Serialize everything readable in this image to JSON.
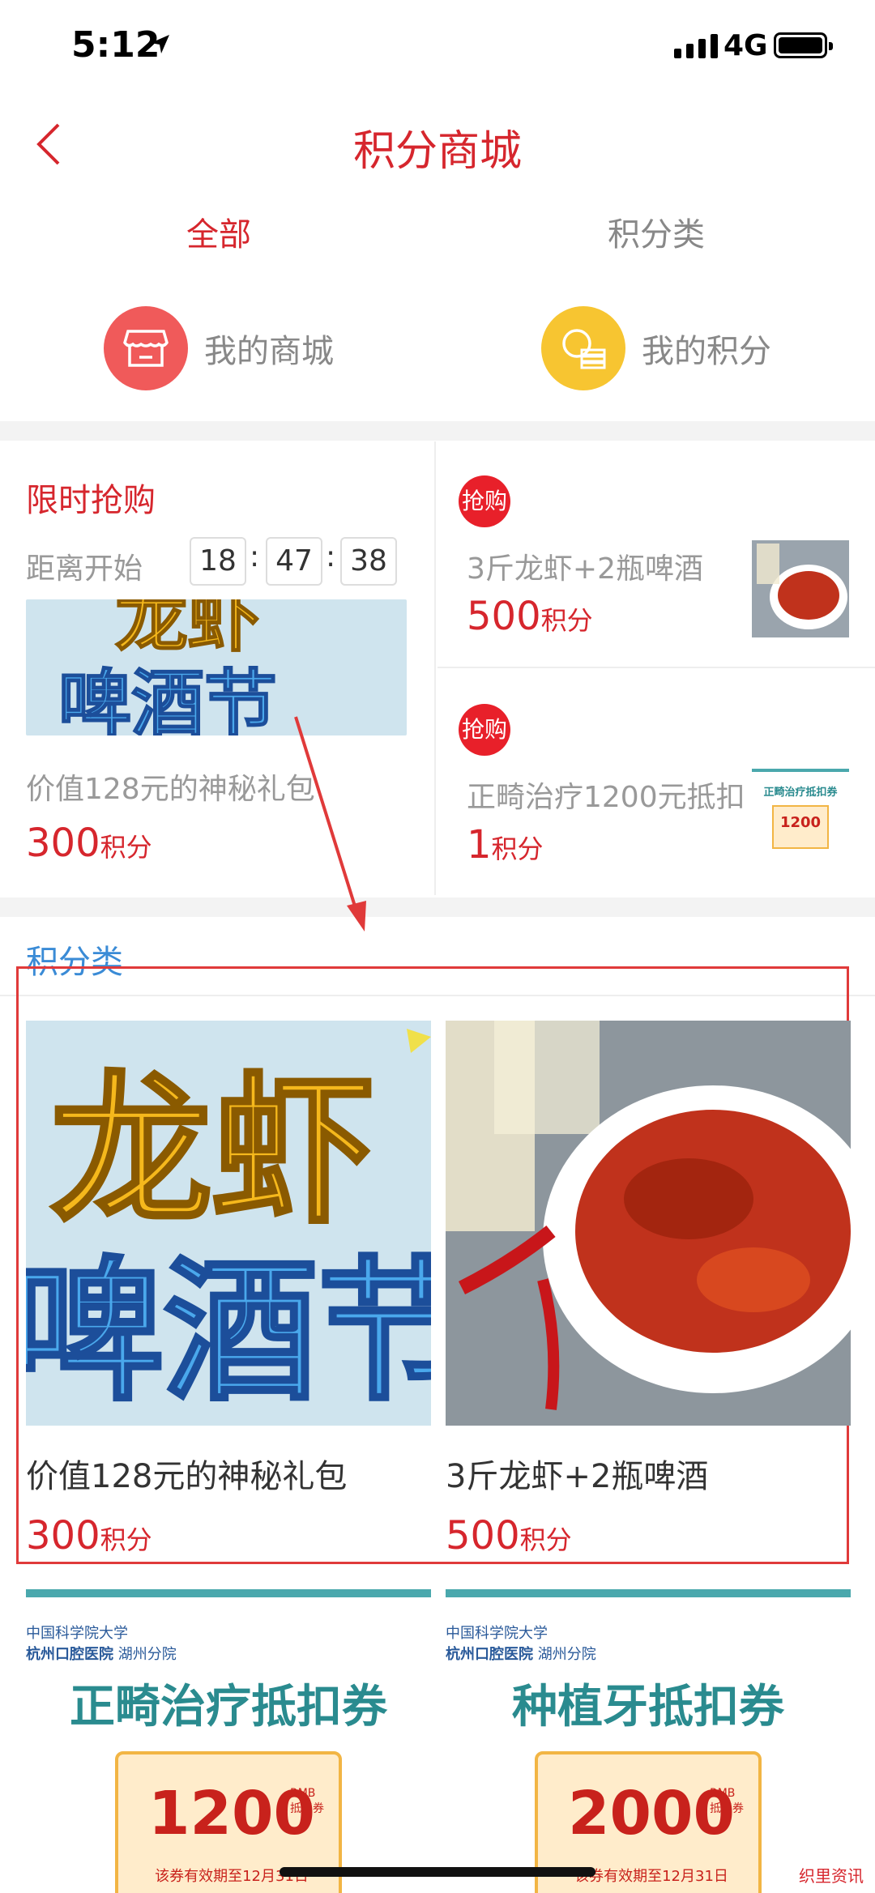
{
  "status_bar": {
    "time": "5:12",
    "network": "4G"
  },
  "nav": {
    "title": "积分商城"
  },
  "tabs": [
    {
      "label": "全部"
    },
    {
      "label": "积分类"
    }
  ],
  "shortcuts": [
    {
      "label": "我的商城",
      "icon": "store-icon",
      "color": "#f05a5a"
    },
    {
      "label": "我的积分",
      "icon": "coins-icon",
      "color": "#f7c531"
    }
  ],
  "flash_sale": {
    "title": "限时抢购",
    "countdown_label": "距离开始",
    "countdown": {
      "h": "18",
      "m": "47",
      "s": "38"
    },
    "main_item": {
      "name": "价值128元的神秘礼包",
      "points": "300",
      "unit": "积分",
      "banner_line1": "龙虾",
      "banner_line2": "啤酒节"
    },
    "items": [
      {
        "badge": "抢购",
        "name": "3斤龙虾+2瓶啤酒",
        "points": "500",
        "unit": "积分"
      },
      {
        "badge": "抢购",
        "name": "正畸治疗1200元抵扣",
        "points": "1",
        "unit": "积分",
        "thumb_title": "正畸治疗抵扣券",
        "thumb_amount": "1200"
      }
    ]
  },
  "category": {
    "title": "积分类",
    "products": [
      {
        "name": "价值128元的神秘礼包",
        "points": "300",
        "unit": "积分",
        "banner_line1": "龙虾",
        "banner_line2": "啤酒节"
      },
      {
        "name": "3斤龙虾+2瓶啤酒",
        "points": "500",
        "unit": "积分"
      }
    ],
    "coupons": [
      {
        "logo_line1": "中国科学院大学",
        "logo_line2": "杭州口腔医院",
        "branch": "湖州分院",
        "title": "正畸治疗抵扣券",
        "amount": "1200",
        "rmb": "RMB",
        "tag": "抵用券",
        "validity": "该券有效期至12月31日"
      },
      {
        "logo_line1": "中国科学院大学",
        "logo_line2": "杭州口腔医院",
        "branch": "湖州分院",
        "title": "种植牙抵扣券",
        "amount": "2000",
        "rmb": "RMB",
        "tag": "抵用券",
        "validity": "该券有效期至12月31日"
      }
    ]
  },
  "watermark": "织里资讯",
  "colors": {
    "brand_red": "#d6262d",
    "teal": "#2a8b8f",
    "blue_label": "#3a8bd6"
  }
}
